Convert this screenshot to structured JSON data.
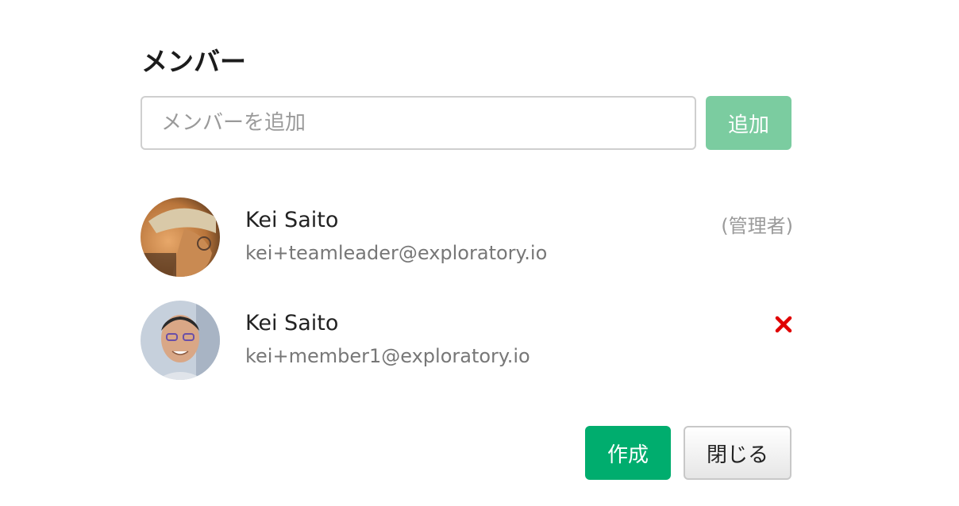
{
  "section": {
    "title": "メンバー"
  },
  "add_member": {
    "placeholder": "メンバーを追加",
    "button_label": "追加",
    "button_color": "#7bcca0"
  },
  "members": [
    {
      "name": "Kei Saito",
      "email": "kei+teamleader@exploratory.io",
      "role": "(管理者)",
      "avatar": "photo-avatar",
      "removable": false
    },
    {
      "name": "Kei Saito",
      "email": "kei+member1@exploratory.io",
      "role": "",
      "avatar": "photo-avatar",
      "removable": true,
      "remove_icon": "close-icon",
      "remove_color": "#e00000"
    }
  ],
  "footer": {
    "create_label": "作成",
    "create_color": "#00ad6e",
    "close_label": "閉じる"
  }
}
